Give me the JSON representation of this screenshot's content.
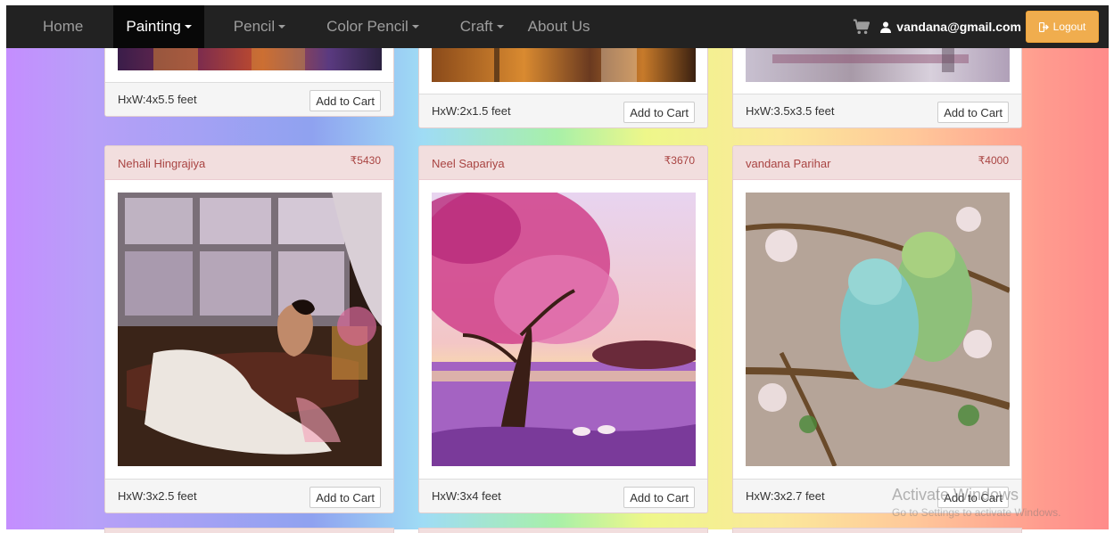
{
  "nav": {
    "items": [
      {
        "label": "Home",
        "dropdown": false
      },
      {
        "label": "Painting",
        "dropdown": true,
        "active": true
      },
      {
        "label": "Pencil",
        "dropdown": true
      },
      {
        "label": "Color Pencil",
        "dropdown": true
      },
      {
        "label": "Craft",
        "dropdown": true
      },
      {
        "label": "About Us",
        "dropdown": false
      }
    ],
    "user_email": "vandana@gmail.com",
    "logout_label": "Logout",
    "logout_color": "#f0ad4e"
  },
  "products_top": [
    {
      "size": "HxW:4x5.5 feet",
      "cart_label": "Add to Cart"
    },
    {
      "size": "HxW:2x1.5 feet",
      "cart_label": "Add to Cart"
    },
    {
      "size": "HxW:3.5x3.5 feet",
      "cart_label": "Add to Cart"
    }
  ],
  "products": [
    {
      "artist": "Nehali Hingrajiya",
      "price": "₹5430",
      "size": "HxW:3x2.5 feet",
      "cart_label": "Add to Cart"
    },
    {
      "artist": "Neel Sapariya",
      "price": "₹3670",
      "size": "HxW:3x4 feet",
      "cart_label": "Add to Cart"
    },
    {
      "artist": "vandana Parihar",
      "price": "₹4000",
      "size": "HxW:3x2.7 feet",
      "cart_label": "Add to Cart"
    }
  ],
  "watermark": {
    "title": "Activate Windows",
    "subtitle": "Go to Settings to activate Windows."
  },
  "icons": {
    "cart": "shopping-cart-icon",
    "user": "user-icon",
    "logout": "logout-icon"
  }
}
